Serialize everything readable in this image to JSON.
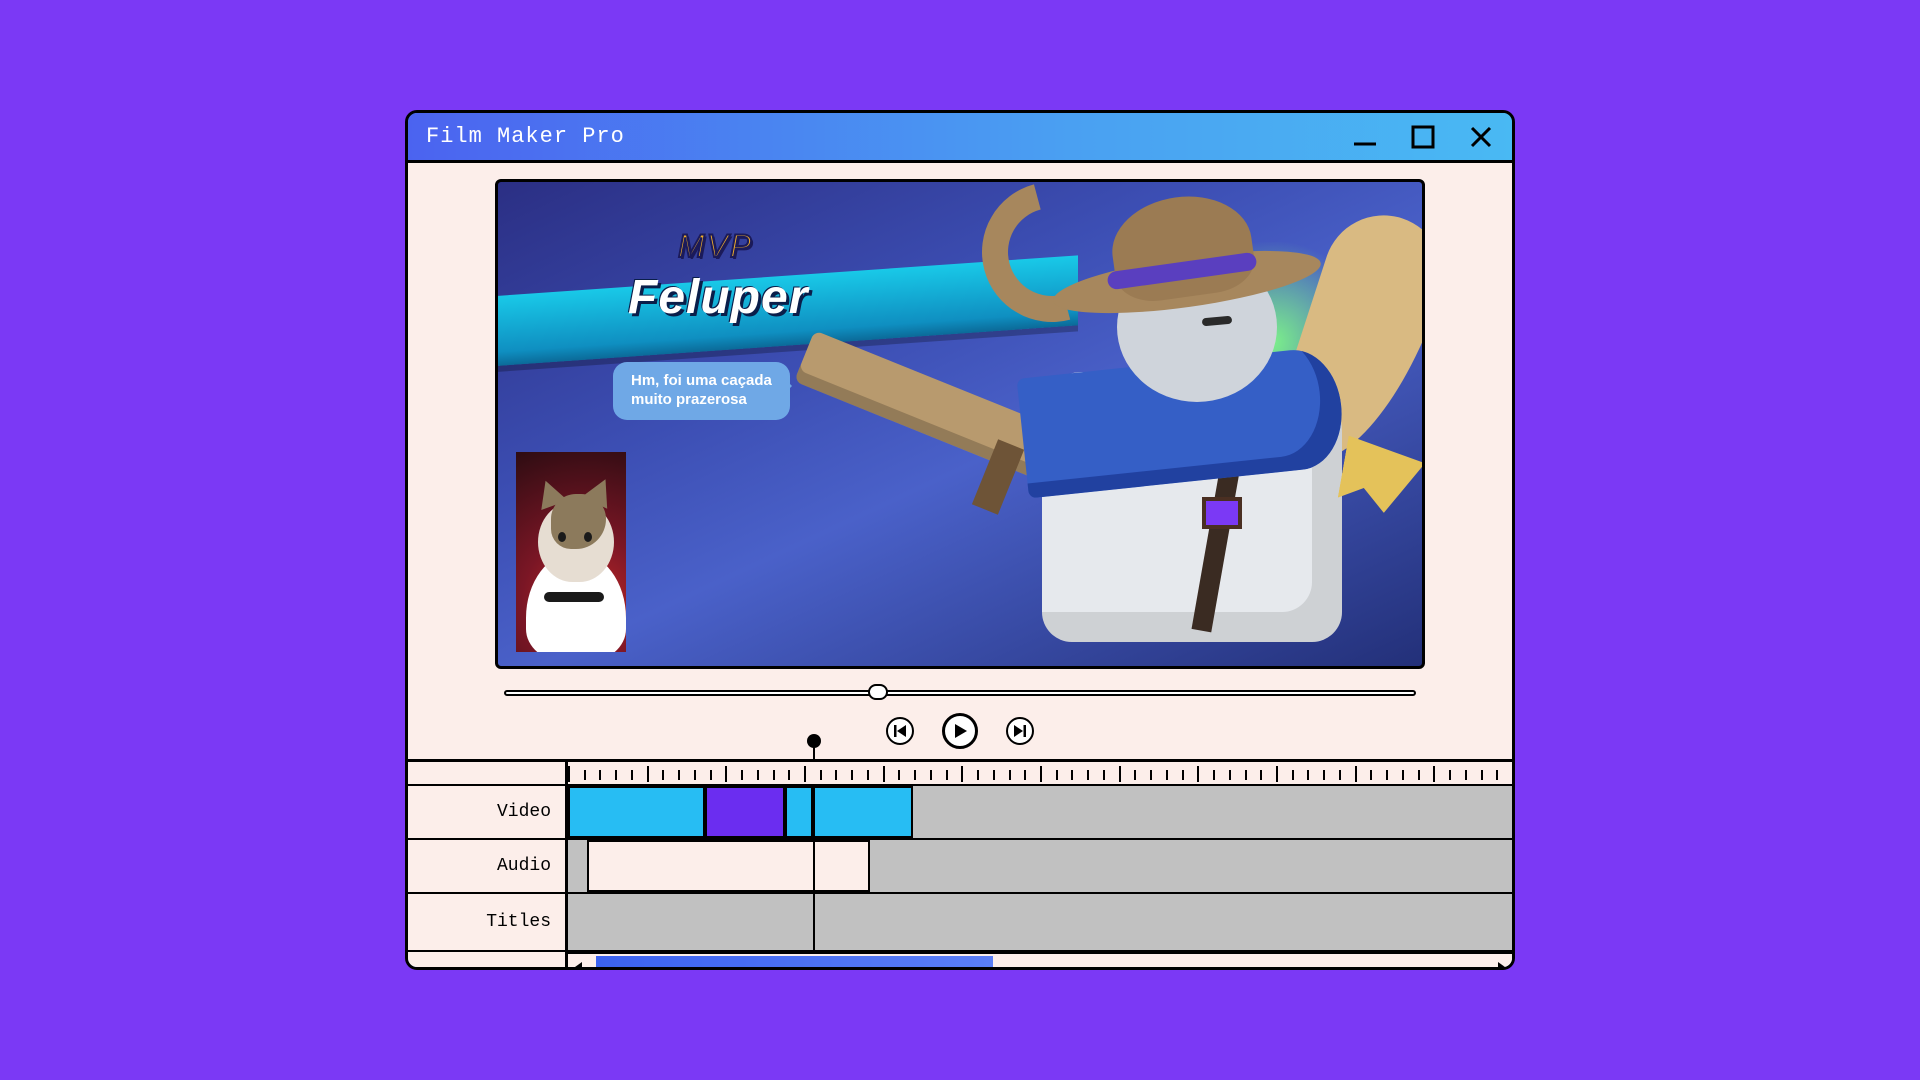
{
  "window": {
    "title": "Film Maker Pro"
  },
  "preview": {
    "mvp_label": "MVP",
    "player_name": "Feluper",
    "speech_line1": "Hm, foi uma caçada",
    "speech_line2": "muito prazerosa",
    "scrub_percent": 41
  },
  "transport": {
    "prev": "prev-frame",
    "play": "play",
    "next": "next-frame"
  },
  "timeline": {
    "tracks": {
      "video_label": "Video",
      "audio_label": "Audio",
      "titles_label": "Titles"
    },
    "playhead_percent": 26,
    "video_clips": [
      {
        "start_pct": 0,
        "width_pct": 14.5,
        "color": "#27bdf3"
      },
      {
        "start_pct": 14.5,
        "width_pct": 8.5,
        "color": "#6b2df0"
      },
      {
        "start_pct": 23,
        "width_pct": 3.0,
        "color": "#27bdf3"
      },
      {
        "start_pct": 26,
        "width_pct": 10.5,
        "color": "#27bdf3"
      }
    ],
    "audio_clips": [
      {
        "start_pct": 2,
        "width_pct": 30,
        "color": "#fceeea"
      }
    ],
    "hscroll": {
      "thumb_start_pct": 3,
      "thumb_width_pct": 42
    }
  },
  "colors": {
    "page_bg": "#7b39f5",
    "panel_bg": "#fceeea",
    "track_bg": "#c1c1c1",
    "clip_cyan": "#27bdf3",
    "clip_purple": "#6b2df0",
    "scroll_thumb": "#4b63f0"
  }
}
